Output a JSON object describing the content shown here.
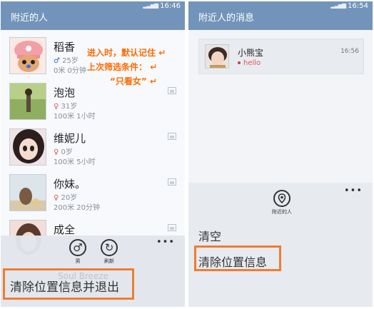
{
  "left": {
    "status": {
      "signal": "▂▃▅▆",
      "time": "16:46"
    },
    "title": "附近的人",
    "people": [
      {
        "name": "稻香",
        "gender": "♂",
        "age": "25岁",
        "distance_time": "0米  0分钟"
      },
      {
        "name": "泡泡",
        "gender": "♀",
        "age": "31岁",
        "distance_time": "100米  1小时"
      },
      {
        "name": "维妮儿",
        "gender": "♀",
        "age": "0岁",
        "distance_time": "100米  5小时"
      },
      {
        "name": "你妹。",
        "gender": "♀",
        "age": "20岁",
        "distance_time": "200米  20分钟"
      },
      {
        "name": "成全",
        "gender": "",
        "age": "",
        "distance_time": ""
      }
    ],
    "annotation": {
      "line1": "进入时，默认记住",
      "line2": "上次筛选条件：",
      "line3": "“只看女”"
    },
    "appbar": {
      "male_label": "男",
      "refresh_label": "刷新",
      "more": "•••",
      "ghost": "Soul Breeze",
      "menu_item": "清除位置信息并退出"
    },
    "colors": {
      "accent": "#7294ba",
      "highlight": "#ed7d31",
      "annotation": "#ff6b00"
    }
  },
  "right": {
    "status": {
      "signal": "▂▃▅▆",
      "time": "16:54"
    },
    "title": "附近人的消息",
    "message": {
      "name": "小熊宝",
      "preview": "hello",
      "time": "16:56"
    },
    "appbar": {
      "nearby_label": "附近的人",
      "more": "•••",
      "menu_clear": "清空",
      "menu_clear_location": "清除位置信息"
    }
  }
}
